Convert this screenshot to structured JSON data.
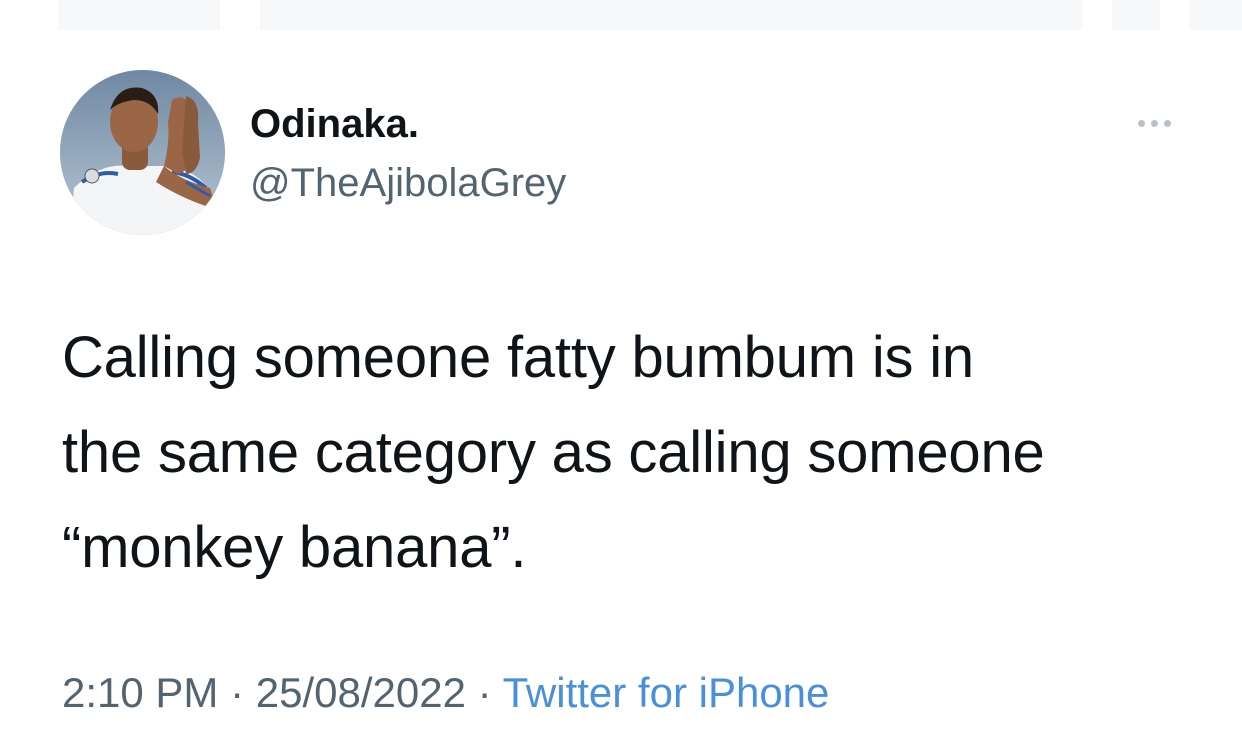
{
  "tweet": {
    "author": {
      "display_name": "Odinaka.",
      "handle": "@TheAjibolaGrey",
      "avatar_icon": "profile-photo"
    },
    "more_icon": "more-horizontal-icon",
    "text_lines": [
      "Calling someone fatty bumbum is in",
      "the same category as calling someone",
      "“monkey banana”."
    ],
    "meta": {
      "time": "2:10 PM",
      "separator": "·",
      "date": "25/08/2022",
      "source": "Twitter for iPhone"
    }
  },
  "colors": {
    "text_primary": "#0f1419",
    "text_secondary": "#536471",
    "link": "#4a90d9",
    "dots": "#b8c1ca"
  }
}
